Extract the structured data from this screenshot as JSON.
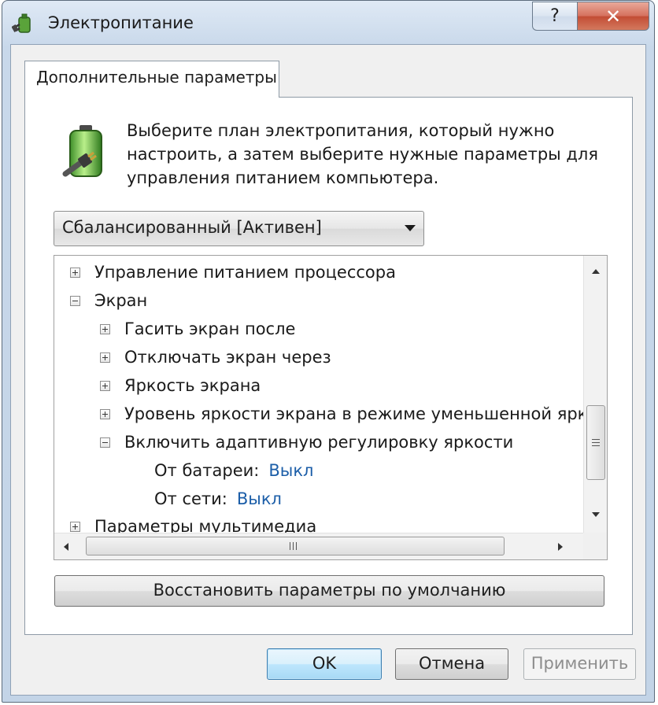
{
  "window": {
    "title": "Электропитание",
    "help_label": "?",
    "close_label": "✕",
    "app_icon": "power-options-icon"
  },
  "tab": {
    "label": "Дополнительные параметры"
  },
  "description": {
    "icon": "battery-plug-icon",
    "lines": [
      "Выберите план электропитания, который нужно",
      "настроить, а затем выберите нужные параметры для",
      "управления питанием компьютера."
    ]
  },
  "plan_select": {
    "selected": "Сбалансированный [Активен]"
  },
  "tree": {
    "items": [
      {
        "label": "Управление питанием процессора",
        "expander": "plus"
      },
      {
        "label": "Экран",
        "expander": "minus"
      },
      {
        "label": "Гасить экран после",
        "expander": "plus"
      },
      {
        "label": "Отключать экран через",
        "expander": "plus"
      },
      {
        "label": "Яркость экрана",
        "expander": "plus"
      },
      {
        "label": "Уровень яркости экрана в режиме уменьшенной яркости",
        "expander": "plus"
      },
      {
        "label": "Включить адаптивную регулировку яркости",
        "expander": "minus"
      },
      {
        "label": "От батареи:",
        "value": "Выкл"
      },
      {
        "label": "От сети:",
        "value": "Выкл"
      },
      {
        "label": "Параметры мультимедиа",
        "expander": "plus"
      }
    ]
  },
  "restore_button": {
    "label": "Восстановить параметры по умолчанию"
  },
  "buttons": {
    "ok": "OK",
    "cancel": "Отмена",
    "apply": "Применить"
  }
}
